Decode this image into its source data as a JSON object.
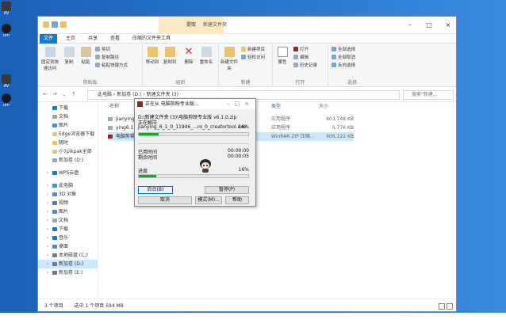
{
  "desktop": {
    "icons": [
      {
        "label": "AV"
      },
      {
        "label": "um"
      },
      {
        "label": "AV"
      },
      {
        "label": "um"
      }
    ]
  },
  "window": {
    "title": "新建文件夹",
    "context_tab": "提取",
    "tabs": [
      "文件",
      "主页",
      "共享",
      "查看",
      "压缩的文件夹工具"
    ],
    "ribbon": {
      "clipboard": {
        "label": "剪贴板",
        "pin": "固定到快速访问",
        "copy": "复制",
        "paste": "粘贴",
        "cut": "剪切",
        "copy_path": "复制路径",
        "paste_shortcut": "粘贴快捷方式"
      },
      "organize": {
        "label": "组织",
        "move_to": "移动到",
        "copy_to": "复制到",
        "delete": "删除",
        "rename": "重命名"
      },
      "new": {
        "label": "新建",
        "new_folder": "新建文件夹",
        "new_item": "新建项目",
        "easy_access": "轻松访问"
      },
      "open": {
        "label": "打开",
        "properties": "属性",
        "open": "打开",
        "edit": "编辑",
        "history": "历史记录"
      },
      "select": {
        "label": "选择",
        "select_all": "全部选择",
        "select_none": "全部取消",
        "invert": "反向选择"
      }
    },
    "address": {
      "path": "此电脑 › 新加卷 (D:) › 新建文件夹 (3)",
      "search_placeholder": "搜索\"新建..."
    },
    "sidebar": [
      {
        "label": "下载"
      },
      {
        "label": "文档"
      },
      {
        "label": "图片"
      },
      {
        "label": "Edge浏览器下载"
      },
      {
        "label": "随时"
      },
      {
        "label": "小7pikpak全部"
      },
      {
        "label": "新加卷 (D:)"
      },
      {
        "label": "WPS云盘"
      },
      {
        "label": "此电脑"
      },
      {
        "label": "3D 对象"
      },
      {
        "label": "视频"
      },
      {
        "label": "图片"
      },
      {
        "label": "文档"
      },
      {
        "label": "下载"
      },
      {
        "label": "音乐"
      },
      {
        "label": "桌面"
      },
      {
        "label": "本地磁盘 (C:)"
      },
      {
        "label": "新加卷 (D:)"
      },
      {
        "label": "新加卷 (E:)"
      }
    ],
    "columns": {
      "name": "名称",
      "type": "类型",
      "size": "大小"
    },
    "files": [
      {
        "name": "Jianying...",
        "type": "应用程序",
        "size": "603,748 KB"
      },
      {
        "name": "ying6.1...",
        "type": "应用程序",
        "size": "5,776 KB"
      },
      {
        "name": "电脑剪辑下载...",
        "type": "WinRAR ZIP 压缩...",
        "size": "606,122 KB"
      }
    ],
    "status": {
      "count": "3 个项目",
      "selected": "选中 1 个项目  594 MB"
    }
  },
  "dialog": {
    "title": "正在从 电脑剪映专业版...",
    "archive": "D:\\新建文件夹 (3)\\电脑剪映专业版 v6.1.0.zip",
    "action": "正在解压",
    "current_file": "Jianying_6_1_0_11946_...ro_0_creatortool.exe",
    "file_percent": "18%",
    "elapsed_label": "已用时间",
    "elapsed": "00:00:00",
    "remaining_label": "剩余时间",
    "remaining": "00:00:05",
    "progress_label": "进度",
    "progress_percent": "16%",
    "file_progress": 0.18,
    "total_progress": 0.16,
    "buttons": {
      "background": "后台(B)",
      "pause": "暂停(P)",
      "cancel": "取消",
      "mode": "模式(M)...",
      "help": "帮助"
    }
  }
}
